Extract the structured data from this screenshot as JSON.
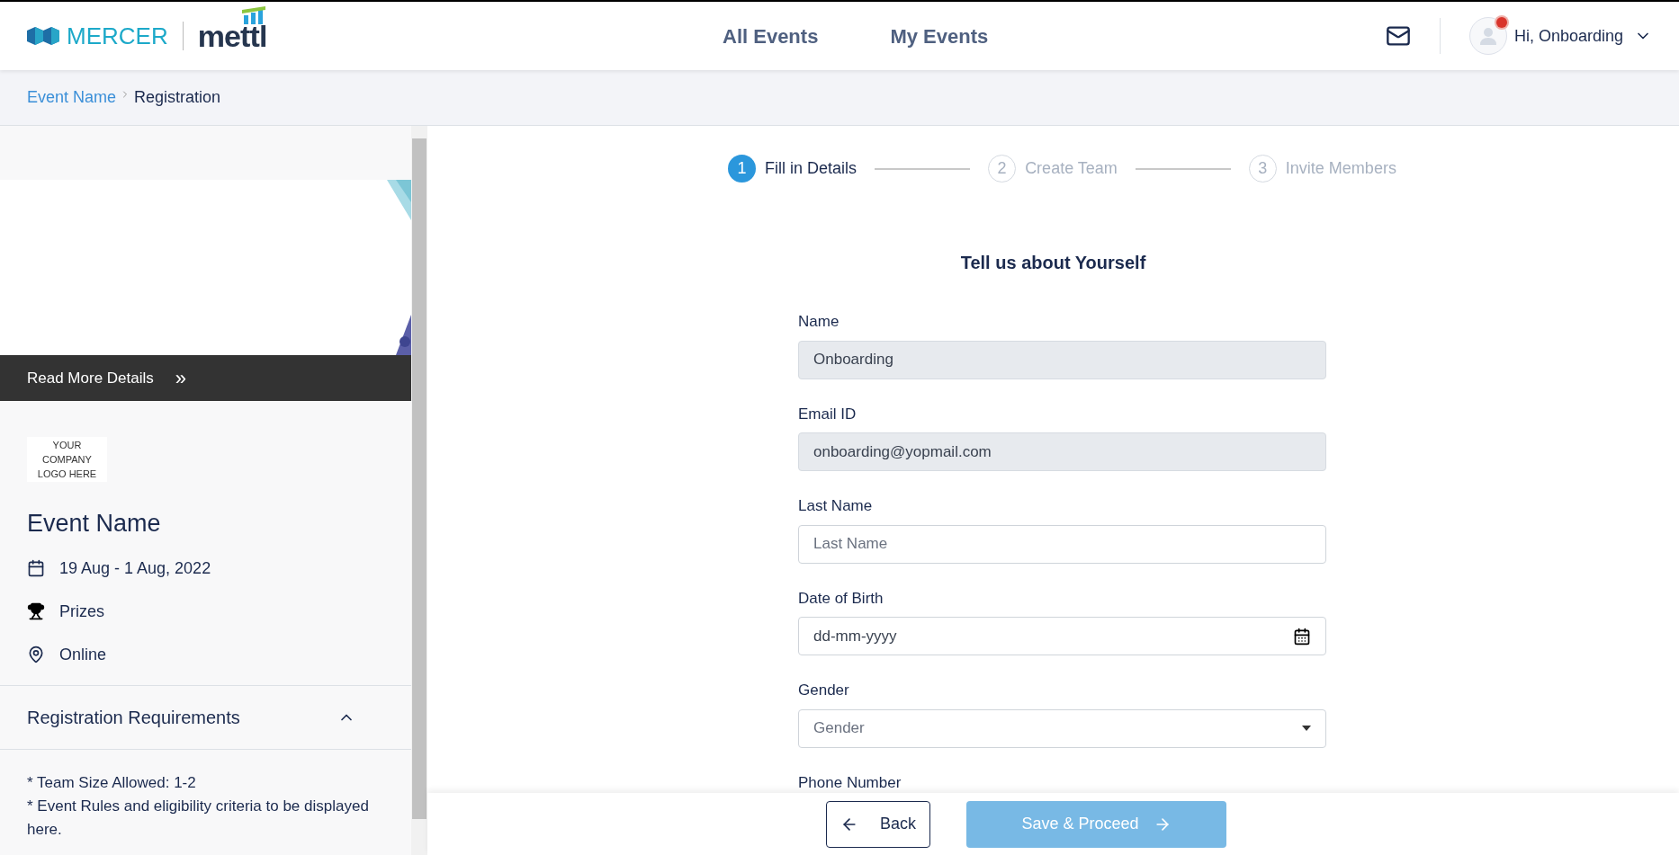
{
  "header": {
    "logo": {
      "brand": "MERCER",
      "product": "mettl"
    },
    "nav": [
      {
        "label": "All Events",
        "selected": false
      },
      {
        "label": "My Events",
        "selected": false
      }
    ],
    "notification": true,
    "user": "Hi, Onboarding"
  },
  "breadcrumb": [
    {
      "label": "Event Name",
      "kind": "link"
    },
    {
      "label": "Registration",
      "kind": "current"
    }
  ],
  "sidebar": {
    "read_more": "Read More Details",
    "read_more_icon": "»",
    "company_logo": "YOUR COMPANY LOGO HERE",
    "event_name": "Event Name",
    "details": [
      {
        "kind": "date",
        "text": "19 Aug - 1 Aug, 2022"
      },
      {
        "kind": "prize",
        "text": "Prizes"
      },
      {
        "kind": "location",
        "text": "Online"
      }
    ],
    "requirements": {
      "title": "Registration Requirements",
      "expanded": true,
      "items": [
        "* Team Size Allowed: 1-2",
        "*  Event Rules and eligibility criteria to be displayed here."
      ]
    }
  },
  "stepper": [
    {
      "number": "1",
      "label": "Fill in Details",
      "selected": true
    },
    {
      "number": "2",
      "label": "Create Team",
      "selected": false
    },
    {
      "number": "3",
      "label": "Invite Members",
      "selected": false
    }
  ],
  "form": {
    "title": "Tell us about Yourself",
    "fields": [
      {
        "label": "Name",
        "kind": "text",
        "value": "Onboarding",
        "disabled": true
      },
      {
        "label": "Email ID",
        "kind": "text",
        "value": "onboarding@yopmail.com",
        "disabled": true
      },
      {
        "label": "Last Name",
        "kind": "text",
        "placeholder": "Last Name",
        "disabled": false
      },
      {
        "label": "Date of Birth",
        "kind": "date",
        "value": "dd-mm-yyyy",
        "disabled": false
      },
      {
        "label": "Gender",
        "kind": "select",
        "placeholder": "Gender",
        "disabled": false
      },
      {
        "label": "Phone Number",
        "kind": "label_only"
      }
    ]
  },
  "footer": {
    "back": "Back",
    "proceed": {
      "label": "Save & Proceed",
      "disabled": true
    }
  }
}
